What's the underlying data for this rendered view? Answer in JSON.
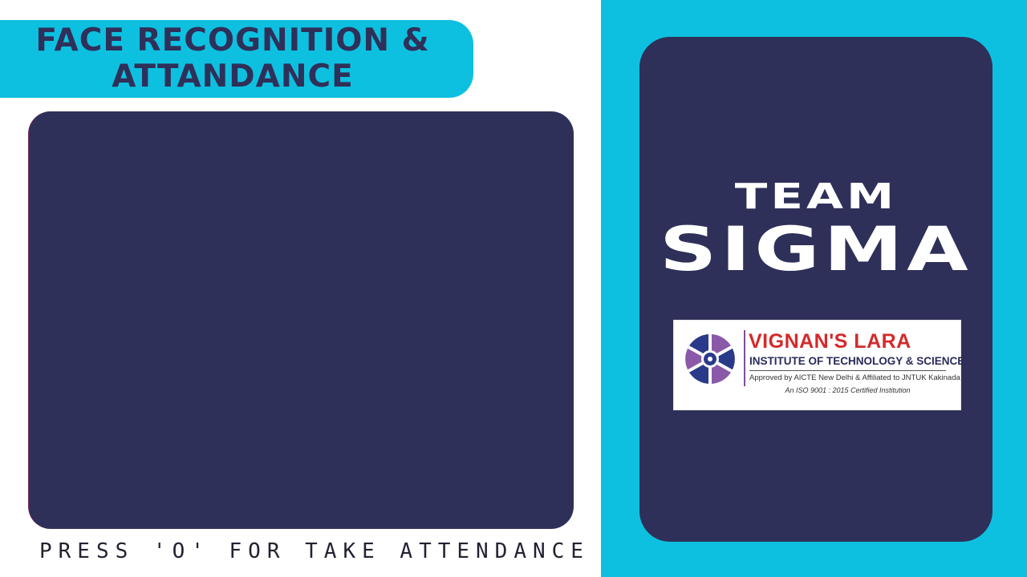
{
  "header": {
    "title_line1": "FACE RECOGNITION &",
    "title_line2": "ATTANDANCE"
  },
  "camera": {
    "instruction": "PRESS 'O' FOR TAKE ATTENDANCE"
  },
  "team": {
    "label": "TEAM",
    "name": "SIGMA"
  },
  "logo": {
    "institution_name": "VIGNAN'S LARA",
    "institution_sub": "INSTITUTE OF TECHNOLOGY & SCIENCE",
    "approval": "Approved by AICTE New Delhi & Affiliated to JNTUK Kakinada",
    "iso": "An ISO 9001 : 2015 Certified Institution",
    "emblem_icon": "vignan-emblem-icon"
  },
  "colors": {
    "accent_cyan": "#0ec0e0",
    "navy": "#2f3059",
    "logo_red": "#d42a2a",
    "logo_purple": "#7d4e9b"
  }
}
